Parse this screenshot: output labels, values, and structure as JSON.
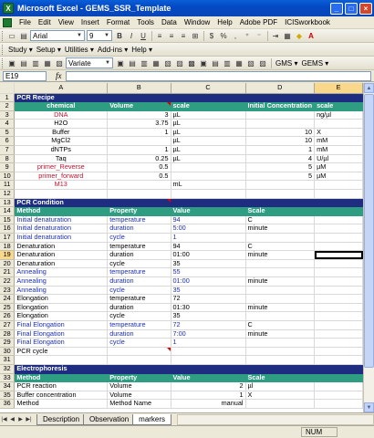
{
  "window": {
    "title": "Microsoft Excel - GEMS_SSR_Template"
  },
  "menu": [
    "File",
    "Edit",
    "View",
    "Insert",
    "Format",
    "Tools",
    "Data",
    "Window",
    "Help",
    "Adobe PDF",
    "ICISworkbook"
  ],
  "toolbar1": {
    "font": "Arial",
    "size": "9",
    "bold": "B",
    "italic": "I",
    "underline": "U",
    "percent": "%",
    "dollar": "$"
  },
  "toolbar2": {
    "items": [
      "Study",
      "Setup",
      "Utilities",
      "Add-ins",
      "Help"
    ]
  },
  "toolbar3": {
    "variate": "Variate",
    "gms": "GMS",
    "gems": "GEMS"
  },
  "formula": {
    "namebox": "E19",
    "fx": "fx",
    "value": ""
  },
  "columns": [
    "A",
    "B",
    "C",
    "D",
    "E"
  ],
  "rows": [
    {
      "n": "1",
      "type": "section",
      "cells": [
        "PCR Recipe",
        "",
        "",
        "",
        ""
      ]
    },
    {
      "n": "2",
      "type": "header",
      "cells": [
        "chemical",
        "Volume",
        "scale",
        "Initial Concentration",
        "scale"
      ]
    },
    {
      "n": "3",
      "cells": [
        "DNA",
        "3",
        "µL",
        "",
        "ng/µl"
      ]
    },
    {
      "n": "4",
      "cells": [
        "H2O",
        "3.75",
        "µL",
        "",
        ""
      ]
    },
    {
      "n": "5",
      "cells": [
        "Buffer",
        "1",
        "µL",
        "10",
        "X"
      ]
    },
    {
      "n": "6",
      "cells": [
        "MgCl2",
        "",
        "µL",
        "10",
        "mM"
      ]
    },
    {
      "n": "7",
      "cells": [
        "dNTPs",
        "1",
        "µL",
        "1",
        "mM"
      ]
    },
    {
      "n": "8",
      "cells": [
        "Taq",
        "0.25",
        "µL",
        "4",
        "U/µl"
      ]
    },
    {
      "n": "9",
      "cells": [
        "primer_Reverse",
        "0.5",
        "",
        "5",
        "µM"
      ]
    },
    {
      "n": "10",
      "cells": [
        "primer_forward",
        "0.5",
        "",
        "5",
        "µM"
      ]
    },
    {
      "n": "11",
      "cells": [
        "M13",
        "",
        "mL",
        "",
        ""
      ]
    },
    {
      "n": "12",
      "cells": [
        "",
        "",
        "",
        "",
        ""
      ]
    },
    {
      "n": "13",
      "type": "section",
      "cells": [
        "PCR Condition",
        "",
        "",
        "",
        ""
      ]
    },
    {
      "n": "14",
      "type": "header",
      "cells": [
        "Method",
        "Property",
        "Value",
        "Scale",
        ""
      ]
    },
    {
      "n": "15",
      "cells": [
        "Initial denaturation",
        "temperature",
        "94",
        "C",
        ""
      ]
    },
    {
      "n": "16",
      "cells": [
        "Initial denaturation",
        "duration",
        "5:00",
        "minute",
        ""
      ]
    },
    {
      "n": "17",
      "cells": [
        "Initial denaturation",
        "cycle",
        "1",
        "",
        ""
      ]
    },
    {
      "n": "18",
      "cells": [
        "Denaturation",
        "temperature",
        "94",
        "C",
        ""
      ]
    },
    {
      "n": "19",
      "cells": [
        "Denaturation",
        "duration",
        "01:00",
        "minute",
        ""
      ]
    },
    {
      "n": "20",
      "cells": [
        "Denaturation",
        "cycle",
        "35",
        "",
        ""
      ]
    },
    {
      "n": "21",
      "cells": [
        "Annealing",
        "temperature",
        "55",
        "",
        ""
      ]
    },
    {
      "n": "22",
      "cells": [
        "Annealing",
        "duration",
        "01:00",
        "minute",
        ""
      ]
    },
    {
      "n": "23",
      "cells": [
        "Annealing",
        "cycle",
        "35",
        "",
        ""
      ]
    },
    {
      "n": "24",
      "cells": [
        "Elongation",
        "temperature",
        "72",
        "",
        ""
      ]
    },
    {
      "n": "25",
      "cells": [
        "Elongation",
        "duration",
        "01:30",
        "minute",
        ""
      ]
    },
    {
      "n": "26",
      "cells": [
        "Elongation",
        "cycle",
        "35",
        "",
        ""
      ]
    },
    {
      "n": "27",
      "cells": [
        "Final Elongation",
        "temperature",
        "72",
        "C",
        ""
      ]
    },
    {
      "n": "28",
      "cells": [
        "Final Elongation",
        "duration",
        "7:00",
        "minute",
        ""
      ]
    },
    {
      "n": "29",
      "cells": [
        "Final Elongation",
        "cycle",
        "1",
        "",
        ""
      ]
    },
    {
      "n": "30",
      "cells": [
        "PCR cycle",
        "",
        "",
        "",
        ""
      ]
    },
    {
      "n": "31",
      "cells": [
        "",
        "",
        "",
        "",
        ""
      ]
    },
    {
      "n": "32",
      "type": "section",
      "cells": [
        "Electrophoresis",
        "",
        "",
        "",
        ""
      ]
    },
    {
      "n": "33",
      "type": "header",
      "cells": [
        "Method",
        "Property",
        "Value",
        "Scale",
        ""
      ]
    },
    {
      "n": "34",
      "cells": [
        "PCR reaction",
        "Volume",
        "2",
        "µl",
        ""
      ]
    },
    {
      "n": "35",
      "cells": [
        "Buffer concentration",
        "Volume",
        "1",
        "X",
        ""
      ]
    },
    {
      "n": "36",
      "cells": [
        "Method",
        "Method Name",
        "manual",
        "",
        ""
      ]
    }
  ],
  "tabs": [
    "Description",
    "Observation",
    "markers"
  ],
  "status": {
    "text": "",
    "num": "NUM"
  }
}
